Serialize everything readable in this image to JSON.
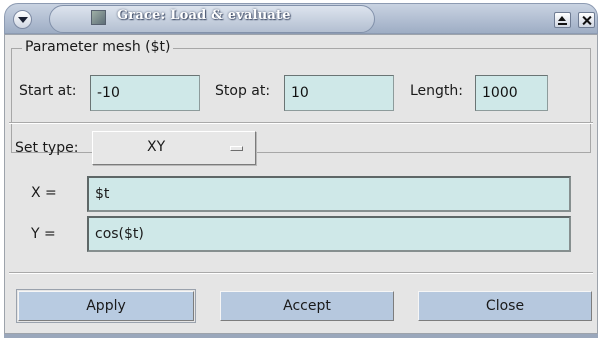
{
  "window": {
    "title": "Grace: Load & evaluate"
  },
  "parameter_mesh": {
    "legend": "Parameter mesh ($t)",
    "start_label": "Start at:",
    "start_value": "-10",
    "stop_label": "Stop at:",
    "stop_value": "10",
    "length_label": "Length:",
    "length_value": "1000"
  },
  "set_type": {
    "label": "Set type:",
    "selected": "XY"
  },
  "formulas": {
    "x_label": "X =",
    "x_value": "$t",
    "y_label": "Y =",
    "y_value": "cos($t)"
  },
  "buttons": {
    "apply": "Apply",
    "accept": "Accept",
    "close": "Close"
  },
  "colors": {
    "field_bg": "#cfe8e8",
    "button_bg": "#b6c8de",
    "dialog_bg": "#e5e5e5",
    "titlebar": "#b3bfd1"
  },
  "icons": [
    "window-menu-icon",
    "app-icon",
    "shade-icon",
    "close-icon"
  ]
}
